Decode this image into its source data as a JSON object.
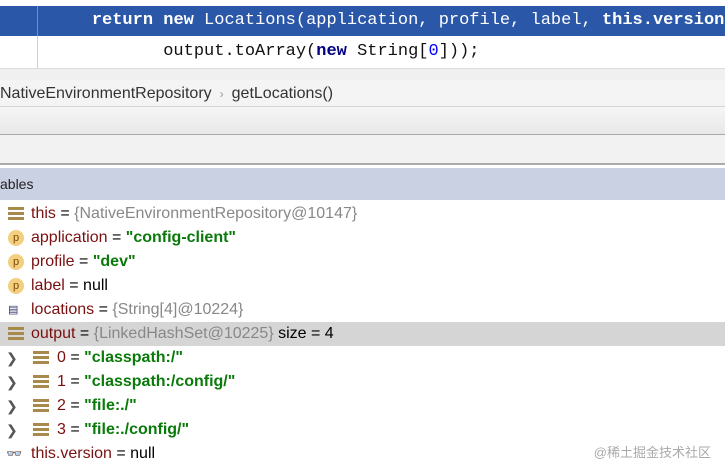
{
  "code": {
    "line1": {
      "kw1": "return",
      "kw2": "new",
      "rest": " Locations(application, profile, label, ",
      "kw3": "this",
      "tail": ".version,"
    },
    "line2": {
      "a": "output.toArray(",
      "kw": "new",
      "b": " String[",
      "num": "0",
      "c": "]));"
    }
  },
  "breadcrumb": {
    "class": "NativeEnvironmentRepository",
    "method": "getLocations()",
    "sep": "›"
  },
  "variables_header": "ables",
  "variables": [
    {
      "icon": "field-icon",
      "name": "this",
      "value": "{NativeEnvironmentRepository@10147}",
      "type": "ref"
    },
    {
      "icon": "parameter-icon",
      "badge": "p",
      "name": "application",
      "value": "\"config-client\"",
      "type": "str"
    },
    {
      "icon": "parameter-icon",
      "badge": "p",
      "name": "profile",
      "value": "\"dev\"",
      "type": "str"
    },
    {
      "icon": "parameter-icon",
      "badge": "p",
      "name": "label",
      "value": "null",
      "type": "plain"
    },
    {
      "icon": "array-icon",
      "name": "locations",
      "value": "{String[4]@10224}",
      "type": "ref"
    },
    {
      "icon": "field-icon",
      "name": "output",
      "value": "{LinkedHashSet@10225}",
      "extra": "size = 4",
      "type": "ref",
      "selected": true
    },
    {
      "child": true,
      "name": "0",
      "value": "\"classpath:/\"",
      "type": "str"
    },
    {
      "child": true,
      "name": "1",
      "value": "\"classpath:/config/\"",
      "type": "str"
    },
    {
      "child": true,
      "name": "2",
      "value": "\"file:./\"",
      "type": "str"
    },
    {
      "child": true,
      "name": "3",
      "value": "\"file:./config/\"",
      "type": "str"
    },
    {
      "icon": "watch-icon",
      "name": "this.version",
      "value": "null",
      "type": "plain"
    }
  ],
  "watermark": "@稀土掘金技术社区"
}
